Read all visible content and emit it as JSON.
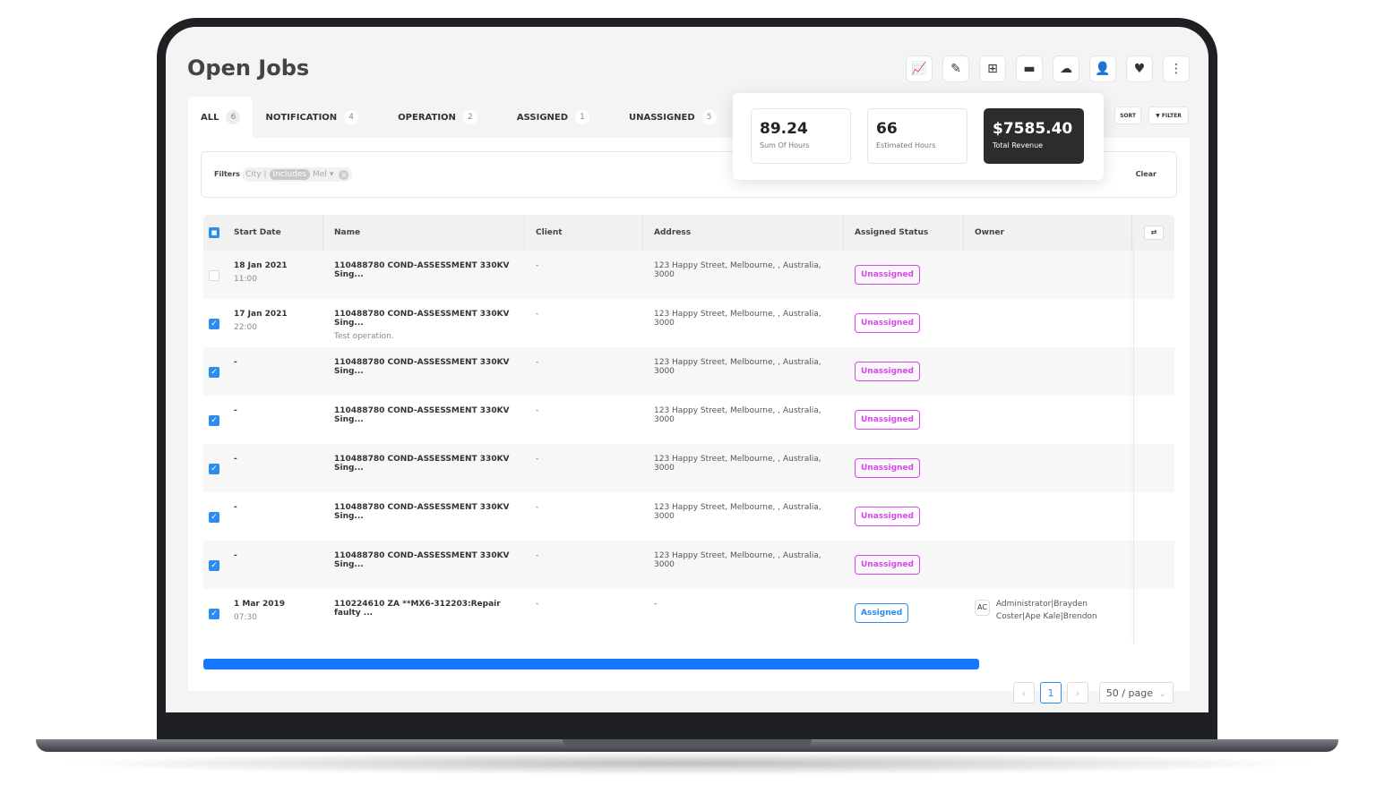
{
  "header": {
    "title": "Open Jobs"
  },
  "toolbar": [
    {
      "icon": "chart-icon",
      "g": "📈"
    },
    {
      "icon": "edit-list-icon",
      "g": "✎"
    },
    {
      "icon": "folder-add-icon",
      "g": "⊞"
    },
    {
      "icon": "folder-remove-icon",
      "g": "▬"
    },
    {
      "icon": "cloud-upload-icon",
      "g": "☁"
    },
    {
      "icon": "user-icon",
      "g": "👤"
    },
    {
      "icon": "heart-icon",
      "g": "♥"
    },
    {
      "icon": "more-icon",
      "g": "⋮"
    }
  ],
  "tabs": [
    {
      "label": "ALL",
      "count": "6"
    },
    {
      "label": "NOTIFICATION",
      "count": "4"
    },
    {
      "label": "OPERATION",
      "count": "2"
    },
    {
      "label": "ASSIGNED",
      "count": "1"
    },
    {
      "label": "UNASSIGNED",
      "count": "5"
    }
  ],
  "stats": [
    {
      "value": "89.24",
      "label": "Sum Of Hours"
    },
    {
      "value": "66",
      "label": "Estimated Hours"
    },
    {
      "value": "$7585.40",
      "label": "Total Revenue"
    }
  ],
  "buttons": {
    "sort": "SORT",
    "filter": "FILTER",
    "clear": "Clear"
  },
  "filters": {
    "label": "Filters",
    "field": "City |",
    "operator": "Includes",
    "value": "Mel"
  },
  "columns": [
    "Start Date",
    "Name",
    "Client",
    "Address",
    "Assigned Status",
    "Owner"
  ],
  "rows": [
    {
      "checked": false,
      "date": "18 Jan 2021",
      "time": "11:00",
      "name": "110488780 COND-ASSESSMENT 330KV Sing...",
      "desc": "",
      "client": "-",
      "address": "123 Happy Street, Melbourne, , Australia, 3000",
      "status": "Unassigned",
      "owner": "",
      "owner_initials": ""
    },
    {
      "checked": true,
      "date": "17 Jan 2021",
      "time": "22:00",
      "name": "110488780 COND-ASSESSMENT 330KV Sing...",
      "desc": "Test operation.",
      "client": "-",
      "address": "123 Happy Street, Melbourne, , Australia, 3000",
      "status": "Unassigned",
      "owner": "",
      "owner_initials": ""
    },
    {
      "checked": true,
      "date": "-",
      "time": "",
      "name": "110488780 COND-ASSESSMENT 330KV Sing...",
      "desc": "",
      "client": "-",
      "address": "123 Happy Street, Melbourne, , Australia, 3000",
      "status": "Unassigned",
      "owner": "",
      "owner_initials": ""
    },
    {
      "checked": true,
      "date": "-",
      "time": "",
      "name": "110488780 COND-ASSESSMENT 330KV Sing...",
      "desc": "",
      "client": "-",
      "address": "123 Happy Street, Melbourne, , Australia, 3000",
      "status": "Unassigned",
      "owner": "",
      "owner_initials": ""
    },
    {
      "checked": true,
      "date": "-",
      "time": "",
      "name": "110488780 COND-ASSESSMENT 330KV Sing...",
      "desc": "",
      "client": "-",
      "address": "123 Happy Street, Melbourne, , Australia, 3000",
      "status": "Unassigned",
      "owner": "",
      "owner_initials": ""
    },
    {
      "checked": true,
      "date": "-",
      "time": "",
      "name": "110488780 COND-ASSESSMENT 330KV Sing...",
      "desc": "",
      "client": "-",
      "address": "123 Happy Street, Melbourne, , Australia, 3000",
      "status": "Unassigned",
      "owner": "",
      "owner_initials": ""
    },
    {
      "checked": true,
      "date": "-",
      "time": "",
      "name": "110488780 COND-ASSESSMENT 330KV Sing...",
      "desc": "",
      "client": "-",
      "address": "123 Happy Street, Melbourne, , Australia, 3000",
      "status": "Unassigned",
      "owner": "",
      "owner_initials": ""
    },
    {
      "checked": true,
      "date": "1 Mar 2019",
      "time": "07:30",
      "name": "110224610 ZA **MX6-312203:Repair faulty ...",
      "desc": "",
      "client": "-",
      "address": "-",
      "status": "Assigned",
      "owner": "Administrator|Brayden Coster|Ape Kale|Brendon Herbert|David Moor",
      "owner_initials": "AC"
    }
  ],
  "pagination": {
    "current": "1",
    "page_size": "50 / page"
  },
  "colors": {
    "accent": "#2d8cf0",
    "unassigned": "#d946ef",
    "dark_card": "#2c2c2c"
  }
}
